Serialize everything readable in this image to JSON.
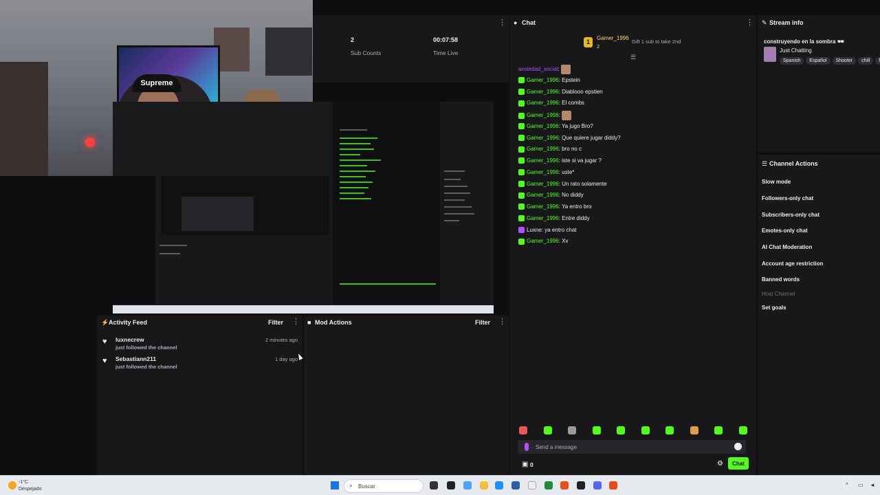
{
  "colors": {
    "accent": "#53fc18",
    "background": "#0e0e10",
    "panel": "#18181b",
    "purple_user": "#b24cff",
    "gifter_gold": "#ffd36c"
  },
  "webcam": {
    "cap_text": "Supreme"
  },
  "stats": {
    "sub_counts_value": "2",
    "sub_counts_label": "Sub Counts",
    "time_live_value": "00:07:58",
    "time_live_label": "Time Live"
  },
  "activity_feed": {
    "title": "Activity Feed",
    "filter_label": "Filter",
    "items": [
      {
        "user": "luxnecrew",
        "action": "just followed the channel",
        "time": "2 minutes ago"
      },
      {
        "user": "Sebastiann211",
        "action": "just followed the channel",
        "time": "1 day ago"
      }
    ]
  },
  "mod_actions": {
    "title": "Mod Actions",
    "filter_label": "Filter"
  },
  "chat": {
    "title": "Chat",
    "top_gifter": {
      "name": "Gamer_1996",
      "count": "2",
      "rank": "1",
      "gift_text": "Gift 1 sub to take 2nd"
    },
    "messages": [
      {
        "user": "ansiedad_social",
        "text": "",
        "emote": true,
        "color": "purple",
        "badge": false
      },
      {
        "user": "Gamer_1996",
        "text": "Epstein",
        "color": "green",
        "badge": true
      },
      {
        "user": "Gamer_1996",
        "text": "Diablooo epstien",
        "color": "green",
        "badge": true
      },
      {
        "user": "Gamer_1996",
        "text": "El combs",
        "color": "green",
        "badge": true
      },
      {
        "user": "Gamer_1996",
        "text": "",
        "emote": true,
        "color": "green",
        "badge": true
      },
      {
        "user": "Gamer_1996",
        "text": "Ya jugo Bro?",
        "color": "green",
        "badge": true
      },
      {
        "user": "Gamer_1996",
        "text": "Que quiere jugar diddy?",
        "color": "green",
        "badge": true
      },
      {
        "user": "Gamer_1996",
        "text": "bro no c",
        "color": "green",
        "badge": true
      },
      {
        "user": "Gamer_1996",
        "text": "iste si va jugar ?",
        "color": "green",
        "badge": true
      },
      {
        "user": "Gamer_1996",
        "text": "uste*",
        "color": "green",
        "badge": true
      },
      {
        "user": "Gamer_1996",
        "text": "Un rato solamente",
        "color": "green",
        "badge": true
      },
      {
        "user": "Gamer_1996",
        "text": "No diddy",
        "color": "green",
        "badge": true
      },
      {
        "user": "Gamer_1996",
        "text": "Ya entro bro",
        "color": "green",
        "badge": true
      },
      {
        "user": "Gamer_1996",
        "text": "Entre diddy",
        "color": "green",
        "badge": true
      },
      {
        "user": "Luxne",
        "text": "ya entro chat",
        "color": "white",
        "badge": "purple"
      },
      {
        "user": "Gamer_1996",
        "text": "Xv",
        "color": "green",
        "badge": true
      }
    ],
    "input_placeholder": "Send a message",
    "gift_count": "0",
    "send_label": "Chat"
  },
  "stream_info": {
    "title": "Stream info",
    "stream_title": "construyendo en la sombra 🕶",
    "category": "Just Chatting",
    "tags": [
      "Spanish",
      "Español",
      "Shooter",
      "chill",
      "fr"
    ]
  },
  "channel_actions": {
    "title": "Channel Actions",
    "items": [
      {
        "label": "Slow mode",
        "disabled": false
      },
      {
        "label": "Followers-only chat",
        "disabled": false
      },
      {
        "label": "Subscribers-only chat",
        "disabled": false
      },
      {
        "label": "Emotes-only chat",
        "disabled": false
      },
      {
        "label": "AI Chat Moderation",
        "disabled": false
      },
      {
        "label": "Account age restriction",
        "disabled": false
      },
      {
        "label": "Banned words",
        "disabled": false
      },
      {
        "label": "Host Channel",
        "disabled": true
      },
      {
        "label": "Set goals",
        "disabled": false
      }
    ]
  },
  "taskbar": {
    "temperature": "-1°C",
    "weather": "Despejado",
    "search_placeholder": "Buscar"
  }
}
